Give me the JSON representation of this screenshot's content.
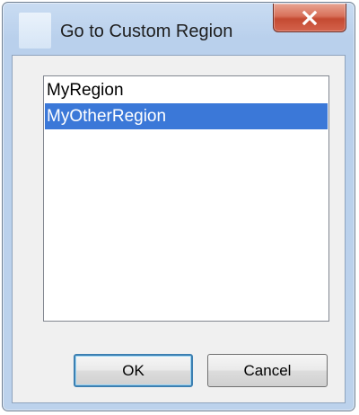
{
  "window": {
    "title": "Go to Custom Region",
    "close_icon": "close-x-icon"
  },
  "list": {
    "items": [
      {
        "label": "MyRegion",
        "selected": false
      },
      {
        "label": "MyOtherRegion",
        "selected": true
      }
    ]
  },
  "buttons": {
    "ok_label": "OK",
    "cancel_label": "Cancel"
  },
  "colors": {
    "selection": "#3b78d8",
    "close_button": "#c44a32",
    "title_bar": "#b9d0ec"
  }
}
